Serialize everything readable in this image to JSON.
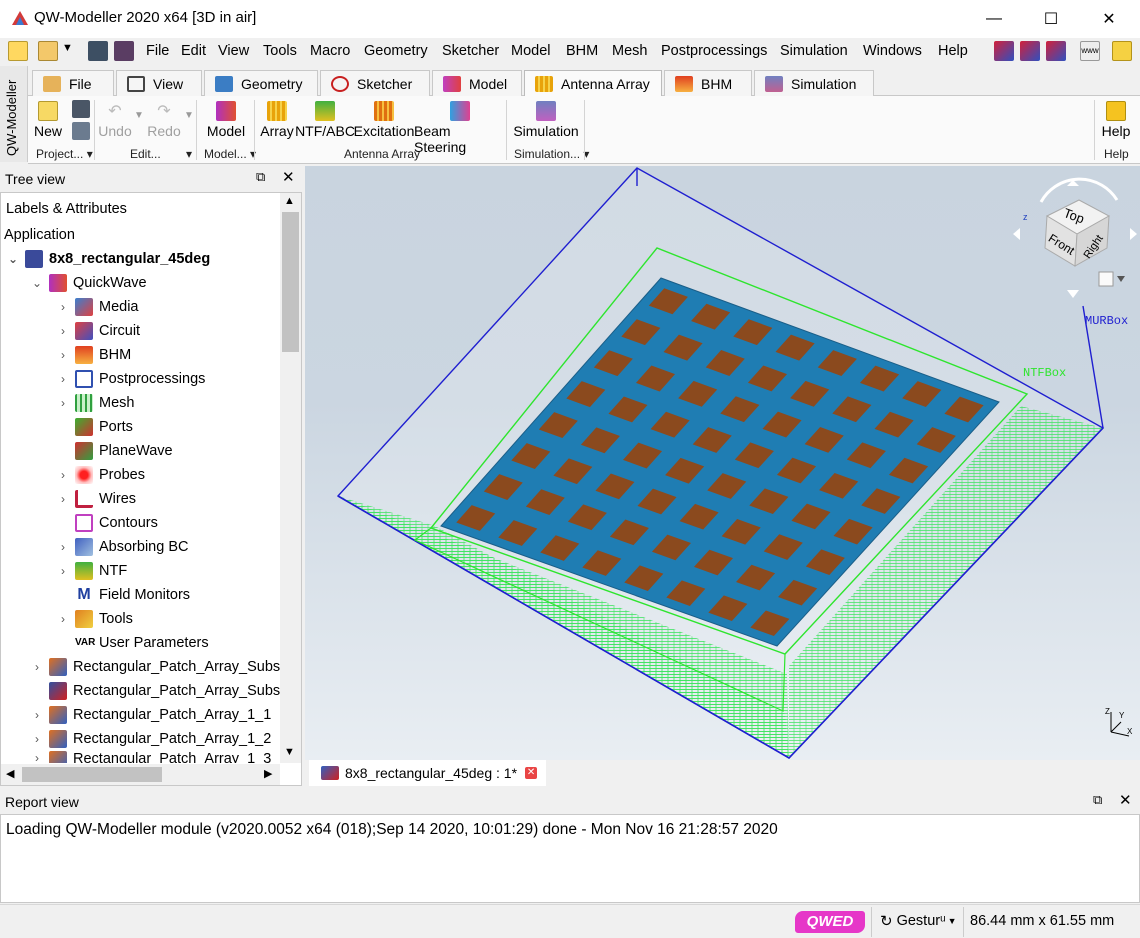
{
  "window": {
    "title": "QW-Modeller 2020 x64 [3D in air]",
    "minimize_icon": "minimize-icon",
    "maximize_icon": "maximize-icon",
    "close_icon": "close-icon"
  },
  "menubar": {
    "items": [
      "File",
      "Edit",
      "View",
      "Tools",
      "Macro",
      "Geometry",
      "Sketcher",
      "Model",
      "BHM",
      "Mesh",
      "Postprocessings",
      "Simulation",
      "Windows",
      "Help"
    ]
  },
  "sidebar_tab": {
    "label": "QW-Modeller"
  },
  "ribbon_tabs": [
    "File",
    "View",
    "Geometry",
    "Sketcher",
    "Model",
    "Antenna Array",
    "BHM",
    "Simulation"
  ],
  "active_tab": "Antenna Array",
  "ribbon": {
    "new_label": "New",
    "undo_label": "Undo",
    "redo_label": "Redo",
    "model_label": "Model",
    "array_label": "Array",
    "ntf_abc_label": "NTF/ABC",
    "excitation_label": "Excitation",
    "beam_steering_label": "Beam Steering",
    "simulation_label": "Simulation",
    "help_label": "Help",
    "groups": {
      "project": "Project...",
      "edit": "Edit...",
      "model": "Model...",
      "antenna_array": "Antenna Array",
      "simulation": "Simulation...",
      "help": "Help"
    }
  },
  "tree_view": {
    "title": "Tree view",
    "header": "Labels & Attributes",
    "application": "Application",
    "project": "8x8_rectangular_45deg",
    "quickwave": "QuickWave",
    "children": [
      "Media",
      "Circuit",
      "BHM",
      "Postprocessings",
      "Mesh",
      "Ports",
      "PlaneWave",
      "Probes",
      "Wires",
      "Contours",
      "Absorbing BC",
      "NTF",
      "Field Monitors",
      "Tools",
      "User Parameters"
    ],
    "objects": [
      "Rectangular_Patch_Array_Subst",
      "Rectangular_Patch_Array_Subst",
      "Rectangular_Patch_Array_1_1",
      "Rectangular_Patch_Array_1_2",
      "Rectangular_Patch_Array_1_3"
    ]
  },
  "viewport": {
    "box_label_mur": "MURBox",
    "box_label_ntf": "NTFBox",
    "view_cube": {
      "top": "Top",
      "front": "Front",
      "right": "Right"
    },
    "colors": {
      "substrate": "#1f7db3",
      "patch": "#8b4a1e",
      "mur_edge": "#1f1fd0",
      "ntf_edge": "#2ee52e",
      "mesh": "#37e35a"
    },
    "patch_grid": {
      "rows": 8,
      "cols": 8
    }
  },
  "document_tab": {
    "label": "8x8_rectangular_45deg : 1*"
  },
  "report_view": {
    "title": "Report view",
    "message": "Loading QW-Modeller module (v2020.0052 x64 (018);Sep 14 2020, 10:01:29) done - Mon Nov 16 21:28:57 2020"
  },
  "statusbar": {
    "logo_text": "QWED",
    "gesture_label": "Gesturᵘ",
    "dimensions": "86.44 mm x 61.55 mm"
  }
}
